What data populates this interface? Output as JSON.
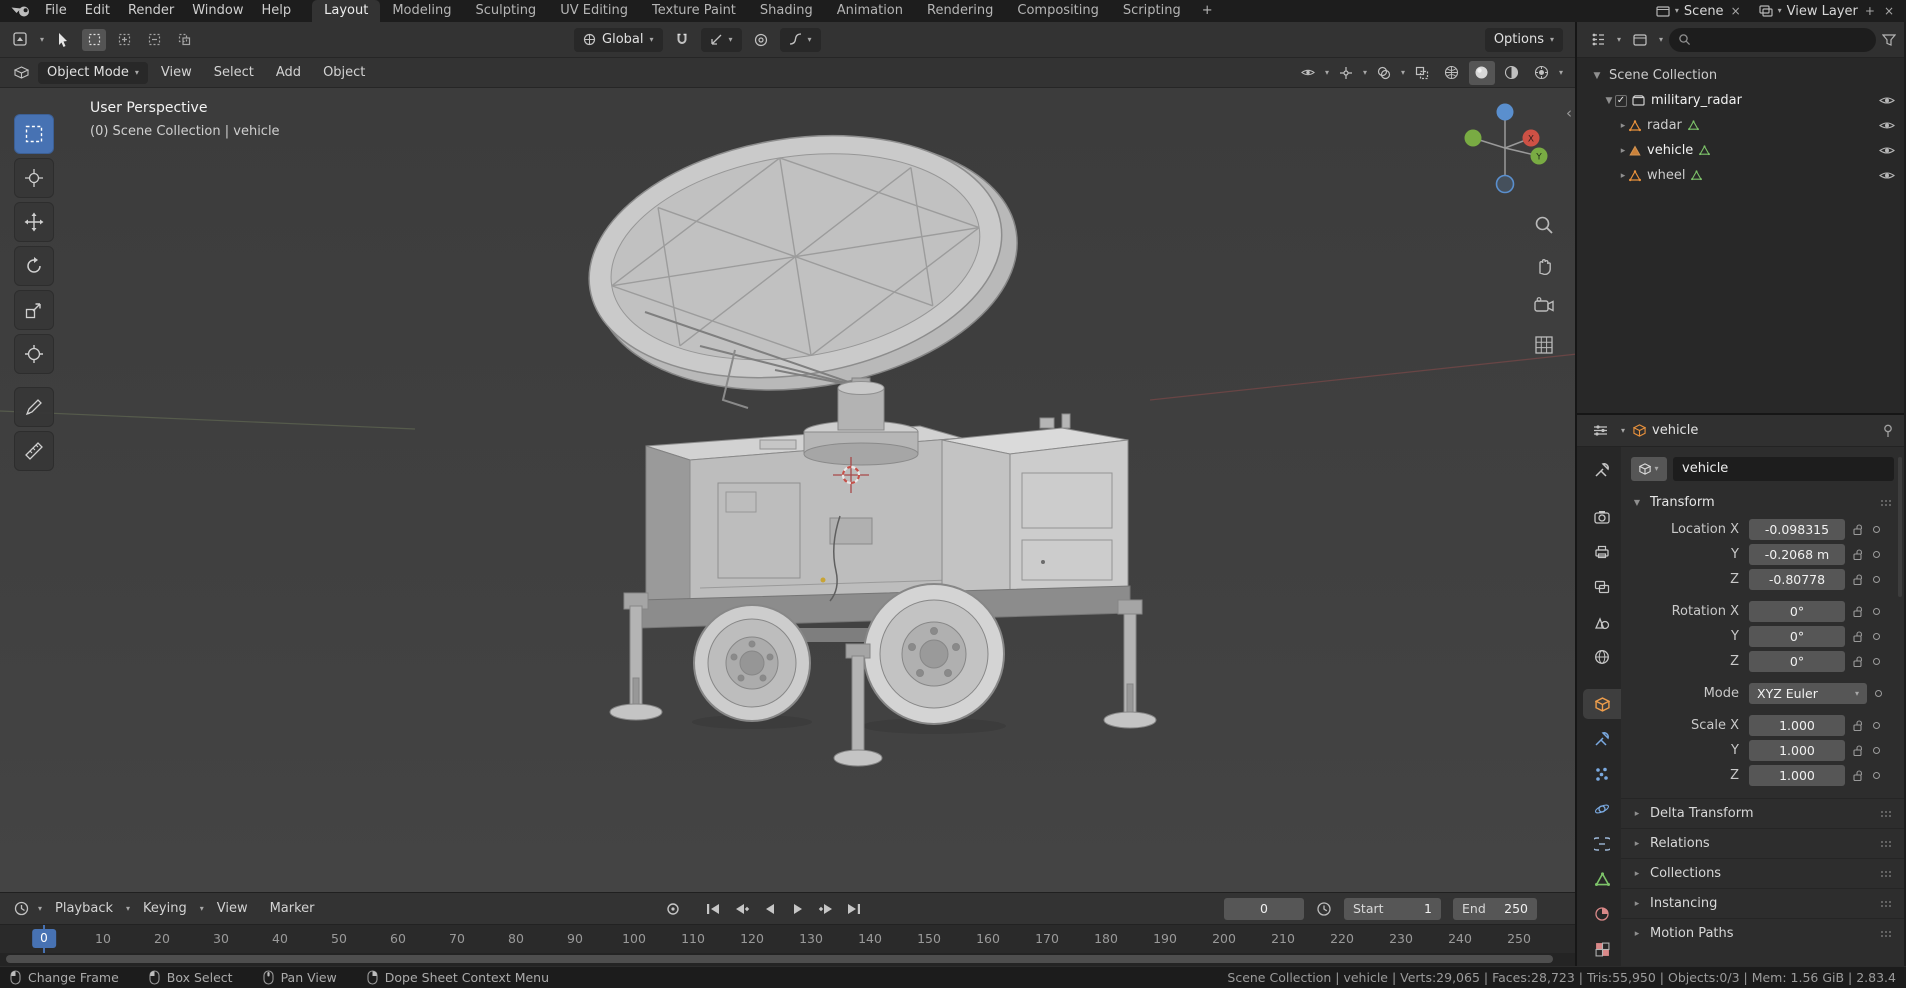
{
  "icons": {
    "chevron_down": "▾",
    "tri_down": "▼",
    "tri_right": "▸",
    "plus": "+",
    "close": "×",
    "collapse_left": "‹",
    "check": "✓"
  },
  "topbar": {
    "menus": [
      "File",
      "Edit",
      "Render",
      "Window",
      "Help"
    ],
    "workspaces": [
      "Layout",
      "Modeling",
      "Sculpting",
      "UV Editing",
      "Texture Paint",
      "Shading",
      "Animation",
      "Rendering",
      "Compositing",
      "Scripting"
    ],
    "scene_label": "Scene",
    "view_layer_label": "View Layer"
  },
  "tool_header": {
    "orientation": "Global",
    "options_label": "Options"
  },
  "viewport_header": {
    "mode": "Object Mode",
    "menus": [
      "View",
      "Select",
      "Add",
      "Object"
    ]
  },
  "viewport": {
    "perspective_label": "User Perspective",
    "context_label": "(0) Scene Collection | vehicle",
    "gizmo_x": "X",
    "gizmo_y": "Y"
  },
  "outliner": {
    "scene_collection": "Scene Collection",
    "collection": "military_radar",
    "objects": [
      {
        "name": "radar"
      },
      {
        "name": "vehicle"
      },
      {
        "name": "wheel"
      }
    ]
  },
  "properties": {
    "breadcrumb": "vehicle",
    "name_value": "vehicle",
    "transform": {
      "title": "Transform",
      "rows": [
        {
          "label": "Location X",
          "value": "-0.098315"
        },
        {
          "label": "Y",
          "value": "-0.2068 m"
        },
        {
          "label": "Z",
          "value": "-0.80778"
        },
        {
          "label": "Rotation X",
          "value": "0°"
        },
        {
          "label": "Y",
          "value": "0°"
        },
        {
          "label": "Z",
          "value": "0°"
        }
      ],
      "mode_label": "Mode",
      "mode_value": "XYZ Euler",
      "scale_rows": [
        {
          "label": "Scale X",
          "value": "1.000"
        },
        {
          "label": "Y",
          "value": "1.000"
        },
        {
          "label": "Z",
          "value": "1.000"
        }
      ]
    },
    "sections": [
      "Delta Transform",
      "Relations",
      "Collections",
      "Instancing",
      "Motion Paths"
    ]
  },
  "timeline": {
    "menus": [
      "Playback",
      "Keying",
      "View",
      "Marker"
    ],
    "current_frame": "0",
    "start_label": "Start",
    "start_value": "1",
    "end_label": "End",
    "end_value": "250",
    "ticks": [
      10,
      20,
      30,
      40,
      50,
      60,
      70,
      80,
      90,
      100,
      110,
      120,
      130,
      140,
      150,
      160,
      170,
      180,
      190,
      200,
      210,
      220,
      230,
      240,
      250
    ]
  },
  "statusbar": {
    "hints": [
      {
        "label": "Change Frame"
      },
      {
        "label": "Box Select"
      },
      {
        "label": "Pan View"
      },
      {
        "label": "Dope Sheet Context Menu"
      }
    ],
    "stats": "Scene Collection | vehicle | Verts:29,065 | Faces:28,723 | Tris:55,950 | Objects:0/3 | Mem: 1.56 GiB | 2.83.4"
  }
}
